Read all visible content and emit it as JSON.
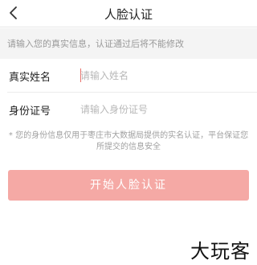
{
  "header": {
    "title": "人脸认证",
    "back_icon": "chevron-left-icon"
  },
  "notice": "请输入您的真实信息，认证通过后将不能修改",
  "form": {
    "name": {
      "label": "真实姓名",
      "placeholder": "请输入姓名",
      "value": ""
    },
    "id_number": {
      "label": "身份证号",
      "placeholder": "请输入身份证号",
      "value": ""
    }
  },
  "disclaimer": "* 您的身份信息仅用于枣庄市大数据局提供的实名认证，平台保证您所提交的信息安全",
  "start_button": "开始人脸认证",
  "watermark": "大玩客",
  "colors": {
    "accent": "#f5a9a5",
    "caret": "#e8716b",
    "notice_bg": "#f4f4f4"
  }
}
